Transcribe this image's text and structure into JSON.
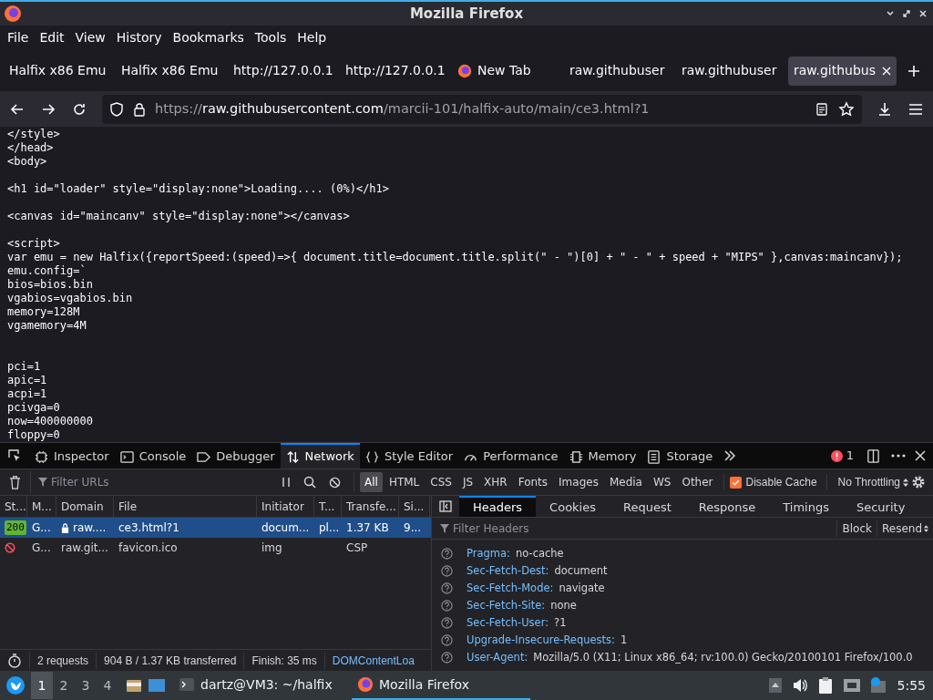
{
  "window": {
    "title": "Mozilla Firefox"
  },
  "menu": [
    "File",
    "Edit",
    "View",
    "History",
    "Bookmarks",
    "Tools",
    "Help"
  ],
  "tabs": [
    {
      "label": "Halfix x86 Emu",
      "selected": false,
      "kind": "plain"
    },
    {
      "label": "Halfix x86 Emu",
      "selected": false,
      "kind": "plain"
    },
    {
      "label": "http://127.0.0.1",
      "selected": false,
      "kind": "plain"
    },
    {
      "label": "http://127.0.0.1",
      "selected": false,
      "kind": "plain"
    },
    {
      "label": "New Tab",
      "selected": false,
      "kind": "firefox"
    },
    {
      "label": "raw.githubuser",
      "selected": false,
      "kind": "plain"
    },
    {
      "label": "raw.githubuser",
      "selected": false,
      "kind": "plain"
    },
    {
      "label": "raw.githubus",
      "selected": true,
      "kind": "plain"
    }
  ],
  "address": {
    "scheme": "https://",
    "host": "raw.githubusercontent.com",
    "path": "/marcii-101/halfix-auto/main/ce3.html?1"
  },
  "source_lines": [
    {
      "kind": "code",
      "text": "</style>"
    },
    {
      "kind": "code",
      "text": "</head>"
    },
    {
      "kind": "code",
      "text": "<body>"
    },
    {
      "kind": "blank"
    },
    {
      "kind": "code",
      "text": "<h1 id=\"loader\" style=\"display:none\">Loading.... (0%)</h1>"
    },
    {
      "kind": "blank"
    },
    {
      "kind": "code",
      "text": "<canvas id=\"maincanv\" style=\"display:none\"></canvas>"
    },
    {
      "kind": "blank"
    },
    {
      "kind": "code",
      "text": "<script>"
    },
    {
      "kind": "code",
      "text": "var emu = new Halfix({reportSpeed:(speed)=>{ document.title=document.title.split(\" - \")[0] + \" - \" + speed + \"MIPS\" },canvas:maincanv});"
    },
    {
      "kind": "code",
      "text": "emu.config=`"
    },
    {
      "kind": "code",
      "text": "bios=bios.bin"
    },
    {
      "kind": "code",
      "text": "vgabios=vgabios.bin"
    },
    {
      "kind": "code",
      "text": "memory=128M"
    },
    {
      "kind": "code",
      "text": "vgamemory=4M"
    },
    {
      "kind": "blank"
    },
    {
      "kind": "blank"
    },
    {
      "kind": "code",
      "text": "pci=1"
    },
    {
      "kind": "code",
      "text": "apic=1"
    },
    {
      "kind": "code",
      "text": "acpi=1"
    },
    {
      "kind": "code",
      "text": "pcivga=0"
    },
    {
      "kind": "code",
      "text": "now=400000000"
    },
    {
      "kind": "code",
      "text": "floppy=0"
    }
  ],
  "devtools": {
    "tabs": [
      {
        "label": "Inspector",
        "selected": false
      },
      {
        "label": "Console",
        "selected": false
      },
      {
        "label": "Debugger",
        "selected": false
      },
      {
        "label": "Network",
        "selected": true
      },
      {
        "label": "Style Editor",
        "selected": false
      },
      {
        "label": "Performance",
        "selected": false
      },
      {
        "label": "Memory",
        "selected": false
      },
      {
        "label": "Storage",
        "selected": false
      }
    ],
    "error_count": "1",
    "filter": {
      "placeholder": "Filter URLs"
    },
    "type_filters": [
      {
        "label": "All",
        "selected": true
      },
      {
        "label": "HTML",
        "selected": false
      },
      {
        "label": "CSS",
        "selected": false
      },
      {
        "label": "JS",
        "selected": false
      },
      {
        "label": "XHR",
        "selected": false
      },
      {
        "label": "Fonts",
        "selected": false
      },
      {
        "label": "Images",
        "selected": false
      },
      {
        "label": "Media",
        "selected": false
      },
      {
        "label": "WS",
        "selected": false
      },
      {
        "label": "Other",
        "selected": false
      }
    ],
    "disable_cache": {
      "label": "Disable Cache",
      "checked": true
    },
    "throttling": "No Throttling",
    "table": {
      "columns": [
        "St...",
        "M...",
        "Domain",
        "File",
        "Initiator",
        "T...",
        "Transfe...",
        "Si..."
      ],
      "rows": [
        {
          "kind": "ok",
          "selected": true,
          "status": "200",
          "method": "G...",
          "domain": "raw....",
          "secure": true,
          "file": "ce3.html?1",
          "initiator": "docum...",
          "type": "pl...",
          "transferred": "1.37 KB",
          "size": "9..."
        },
        {
          "kind": "blocked",
          "selected": false,
          "method": "G...",
          "domain": "raw.git...",
          "secure": false,
          "file": "favicon.ico",
          "initiator": "img",
          "transferred": "CSP"
        }
      ]
    },
    "status_bar": [
      "2 requests",
      "904 B / 1.37 KB transferred",
      "Finish: 35 ms",
      "DOMContentLoa"
    ],
    "details": {
      "tabs": [
        {
          "label": "Headers",
          "selected": true
        },
        {
          "label": "Cookies",
          "selected": false
        },
        {
          "label": "Request",
          "selected": false
        },
        {
          "label": "Response",
          "selected": false
        },
        {
          "label": "Timings",
          "selected": false
        },
        {
          "label": "Security",
          "selected": false
        }
      ],
      "filter": {
        "placeholder": "Filter Headers"
      },
      "buttons": [
        "Block",
        "Resend"
      ],
      "headers": [
        {
          "name": "Pragma:",
          "value": "no-cache"
        },
        {
          "name": "Sec-Fetch-Dest:",
          "value": "document"
        },
        {
          "name": "Sec-Fetch-Mode:",
          "value": "navigate"
        },
        {
          "name": "Sec-Fetch-Site:",
          "value": "none"
        },
        {
          "name": "Sec-Fetch-User:",
          "value": "?1"
        },
        {
          "name": "Upgrade-Insecure-Requests:",
          "value": "1"
        },
        {
          "name": "User-Agent:",
          "value": "Mozilla/5.0 (X11; Linux x86_64; rv:100.0) Gecko/20100101 Firefox/100.0"
        }
      ]
    }
  },
  "taskbar": {
    "workspaces": [
      {
        "label": "1",
        "selected": true
      },
      {
        "label": "2",
        "selected": false
      },
      {
        "label": "3",
        "selected": false
      },
      {
        "label": "4",
        "selected": false
      }
    ],
    "tasks": [
      {
        "label": "dartz@VM3: ~/halfix",
        "selected": false,
        "kind": "terminal"
      },
      {
        "label": "Mozilla Firefox",
        "selected": true,
        "kind": "firefox"
      }
    ],
    "clock": "5:55"
  }
}
